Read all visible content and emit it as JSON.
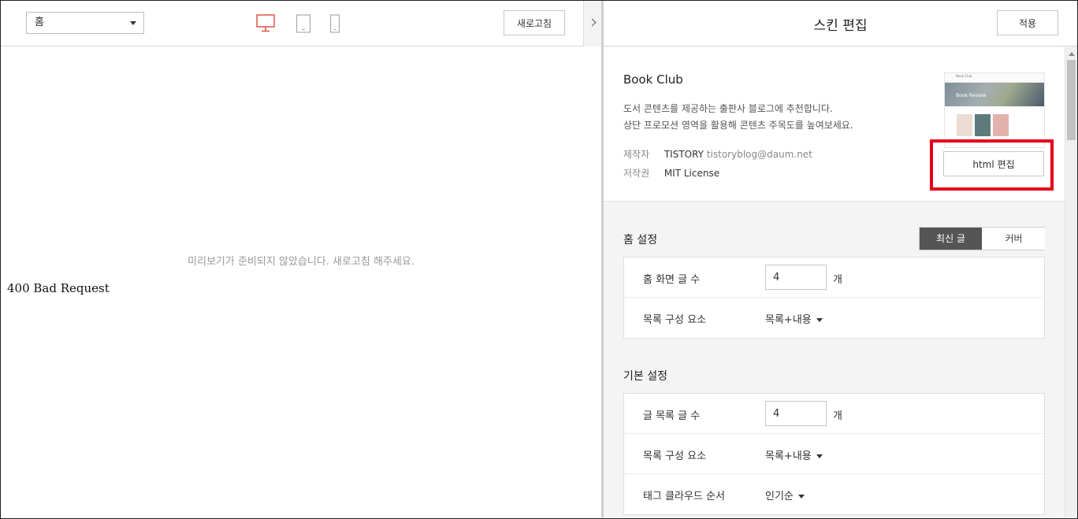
{
  "toolbar": {
    "page_select_value": "홈",
    "refresh_label": "새로고침"
  },
  "preview": {
    "message": "미리보기가 준비되지 않았습니다. 새로고침 해주세요.",
    "error_text": "400 Bad Request"
  },
  "panel": {
    "title": "스킨 편집",
    "apply_label": "적용"
  },
  "skin": {
    "name": "Book Club",
    "desc_line1": "도서 콘텐츠를 제공하는 출판사 블로그에 추천합니다.",
    "desc_line2": "상단 프로모션 영역을 활용해 콘텐츠 주목도를 높여보세요.",
    "author_key": "제작자",
    "author_name": "TISTORY",
    "author_email": "tistoryblog@daum.net",
    "license_key": "저작권",
    "license_value": "MIT License",
    "html_edit_label": "html 편집",
    "thumb_bar_text": "Book Club",
    "thumb_hero_text": "Book Review"
  },
  "home_settings": {
    "title": "홈 설정",
    "tab_recent": "최신 글",
    "tab_cover": "커버",
    "rows": [
      {
        "label": "홈 화면 글 수",
        "value": "4",
        "unit": "개"
      },
      {
        "label": "목록 구성 요소",
        "dropdown": "목록+내용"
      }
    ]
  },
  "basic_settings": {
    "title": "기본 설정",
    "rows": [
      {
        "label": "글 목록 글 수",
        "value": "4",
        "unit": "개"
      },
      {
        "label": "목록 구성 요소",
        "dropdown": "목록+내용"
      },
      {
        "label": "태그 클라우드 순서",
        "dropdown": "인기순"
      }
    ]
  },
  "colors": {
    "active_device": "#e24a3b",
    "highlight_border": "#e4001b",
    "active_tab_bg": "#555555"
  },
  "icons": {
    "desktop": "desktop-icon",
    "tablet": "tablet-icon",
    "mobile": "mobile-icon",
    "collapse": "chevron-right-icon",
    "select_caret": "caret-down-icon"
  }
}
